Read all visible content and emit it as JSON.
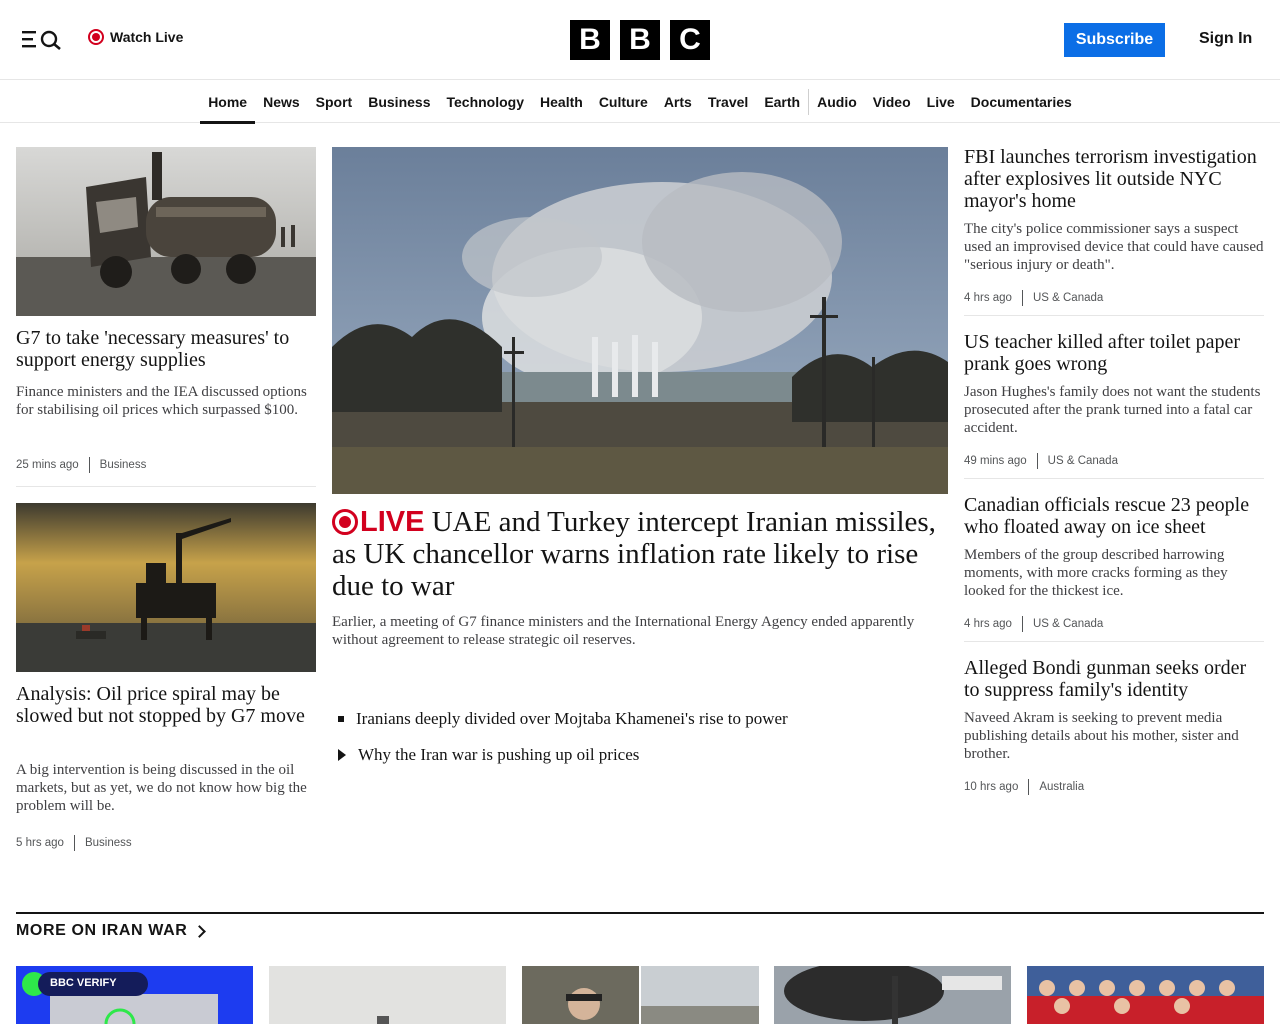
{
  "header": {
    "watch_live": "Watch Live",
    "logo": [
      "B",
      "B",
      "C"
    ],
    "subscribe": "Subscribe",
    "sign_in": "Sign In"
  },
  "nav": {
    "items": [
      "Home",
      "News",
      "Sport",
      "Business",
      "Technology",
      "Health",
      "Culture",
      "Arts",
      "Travel",
      "Earth",
      "Audio",
      "Video",
      "Live",
      "Documentaries"
    ],
    "active": "Home"
  },
  "left": [
    {
      "title": "G7 to take 'necessary measures' to support energy supplies",
      "desc": "Finance ministers and the IEA discussed options for stabilising oil prices which surpassed $100.",
      "time": "25 mins ago",
      "section": "Business"
    },
    {
      "title": "Analysis: Oil price spiral may be slowed but not stopped by G7 move",
      "desc": "A big intervention is being discussed in the oil markets, but as yet, we do not know how big the problem will be.",
      "time": "5 hrs ago",
      "section": "Business"
    }
  ],
  "main": {
    "live_label": "LIVE",
    "title": "UAE and Turkey intercept Iranian missiles, as UK chancellor warns inflation rate likely to rise due to war",
    "desc": "Earlier, a meeting of G7 finance ministers and the International Energy Agency ended apparently without agreement to release strategic oil reserves.",
    "related": [
      "Iranians deeply divided over Mojtaba Khamenei's rise to power",
      "Why the Iran war is pushing up oil prices"
    ]
  },
  "right": [
    {
      "title": "FBI launches terrorism investigation after explosives lit outside NYC mayor's home",
      "desc": "The city's police commissioner says a suspect used an improvised device that could have caused \"serious injury or death\".",
      "time": "4 hrs ago",
      "section": "US & Canada"
    },
    {
      "title": "US teacher killed after toilet paper prank goes wrong",
      "desc": "Jason Hughes's family does not want the students prosecuted after the prank turned into a fatal car accident.",
      "time": "49 mins ago",
      "section": "US & Canada"
    },
    {
      "title": "Canadian officials rescue 23 people who floated away on ice sheet",
      "desc": "Members of the group described harrowing moments, with more cracks forming as they looked for the thickest ice.",
      "time": "4 hrs ago",
      "section": "US & Canada"
    },
    {
      "title": "Alleged Bondi gunman seeks order to suppress family's identity",
      "desc": "Naveed Akram is seeking to prevent media publishing details about his mother, sister and brother.",
      "time": "10 hrs ago",
      "section": "Australia"
    }
  ],
  "section": {
    "title": "MORE ON IRAN WAR",
    "verify_badge": "BBC VERIFY"
  },
  "colors": {
    "accent": "#0b6ee6",
    "live": "#d2001e",
    "text": "#141414"
  }
}
